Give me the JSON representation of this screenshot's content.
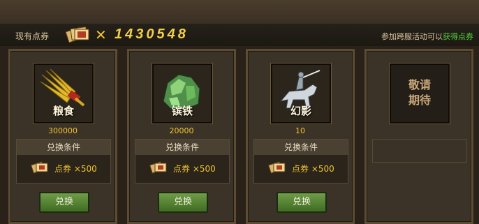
{
  "header": {
    "balance_label": "现有点券",
    "times_symbol": "✕",
    "balance_value": "1430548",
    "note_prefix": "参加跨服活动可以",
    "note_link": "获得点券"
  },
  "cards": [
    {
      "name": "粮食",
      "quantity": "300000",
      "condition_title": "兑换条件",
      "cost": "点券 ×500",
      "button": "兑换",
      "icon": "grain-icon"
    },
    {
      "name": "镔铁",
      "quantity": "20000",
      "condition_title": "兑换条件",
      "cost": "点券 ×500",
      "button": "兑换",
      "icon": "ore-icon"
    },
    {
      "name": "幻影",
      "quantity": "10",
      "condition_title": "兑换条件",
      "cost": "点券 ×500",
      "button": "兑换",
      "icon": "horse-rider-icon"
    }
  ],
  "coming_soon": {
    "line1": "敬请",
    "line2": "期待"
  },
  "colors": {
    "accent": "#f2cf4a",
    "link": "#55d23a",
    "button": "#4f7e31"
  }
}
